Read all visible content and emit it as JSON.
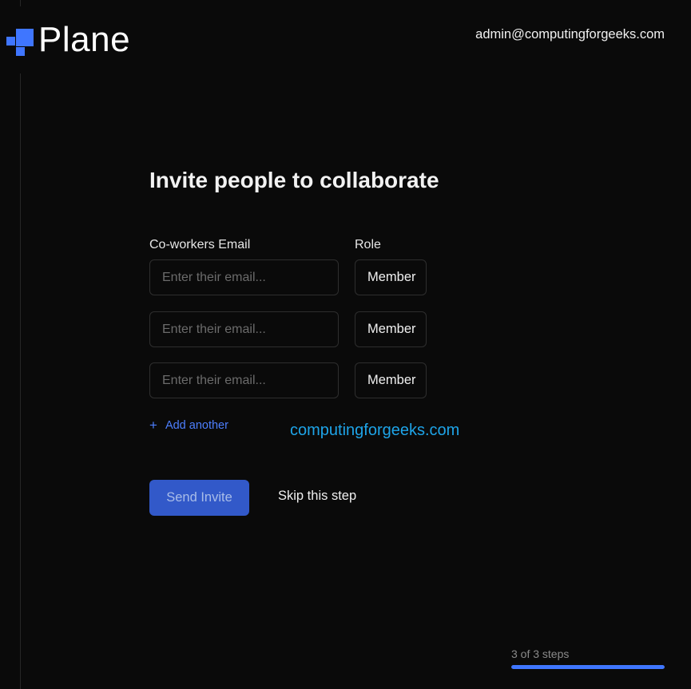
{
  "brand": {
    "name": "Plane",
    "icon": "plane-logo-icon",
    "accent_color": "#3f76ff"
  },
  "header": {
    "user_email": "admin@computingforgeeks.com"
  },
  "main": {
    "title": "Invite people to collaborate",
    "email_column_label": "Co-workers Email",
    "role_column_label": "Role",
    "invite_rows": [
      {
        "email_value": "",
        "email_placeholder": "Enter their email...",
        "role": "Member"
      },
      {
        "email_value": "",
        "email_placeholder": "Enter their email...",
        "role": "Member"
      },
      {
        "email_value": "",
        "email_placeholder": "Enter their email...",
        "role": "Member"
      }
    ],
    "add_another_label": "Add another",
    "add_another_icon": "plus-icon",
    "send_button_label": "Send Invite",
    "skip_label": "Skip this step"
  },
  "watermark": "computingforgeeks.com",
  "progress": {
    "label": "3 of 3 steps",
    "current": 3,
    "total": 3,
    "color": "#3f76ff"
  }
}
